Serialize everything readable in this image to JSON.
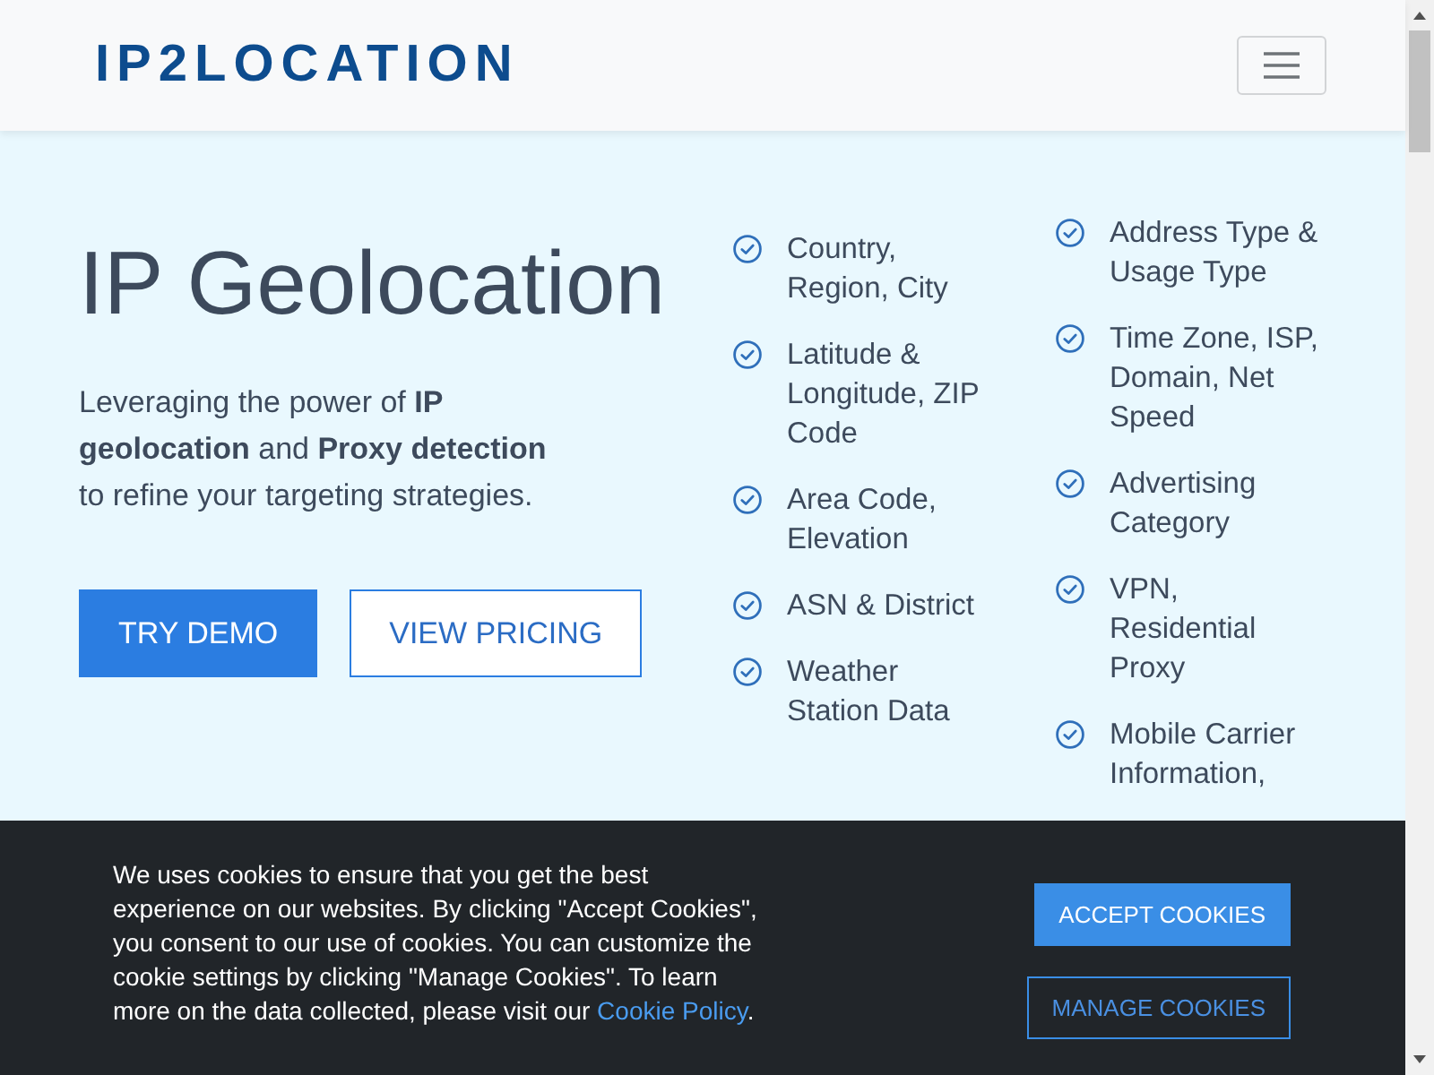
{
  "navbar": {
    "logo": "IP2LOCATION"
  },
  "hero": {
    "title": "IP Geolocation",
    "subtitle": "Leveraging the power of **IP geolocation** and **Proxy detection** to refine your targeting strategies.",
    "buttons": [
      {
        "label": "TRY DEMO",
        "kind": "primary"
      },
      {
        "label": "VIEW PRICING",
        "kind": "outline"
      }
    ]
  },
  "feature_columns": [
    {
      "items": [
        {
          "label": "Country, Region, City"
        },
        {
          "label": "Latitude & Longitude, ZIP Code"
        },
        {
          "label": "Area Code, Elevation"
        },
        {
          "label": "ASN & District"
        },
        {
          "label": "Weather Station Data"
        }
      ]
    },
    {
      "items": [
        {
          "label": "Address Type & Usage Type"
        },
        {
          "label": "Time Zone, ISP, Domain, Net Speed"
        },
        {
          "label": "Advertising Category"
        },
        {
          "label": "VPN, Residential Proxy"
        },
        {
          "label": "Mobile Carrier Information,"
        }
      ]
    }
  ],
  "cookie_banner": {
    "message": "We uses cookies to ensure that you get the best experience on our websites. By clicking \"Accept Cookies\", you consent to our use of cookies. You can customize the cookie settings by clicking \"Manage Cookies\". To learn more on the data collected, please visit our",
    "link": "Cookie Policy",
    "message_end": ".",
    "buttons": [
      {
        "label": "ACCEPT COOKIES",
        "kind": "primary"
      },
      {
        "label": "MANAGE COOKIES",
        "kind": "outline"
      }
    ]
  }
}
